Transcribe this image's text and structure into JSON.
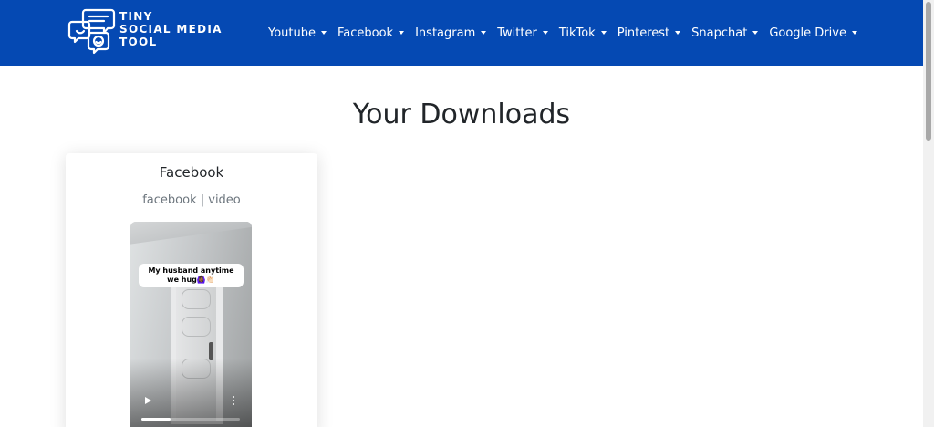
{
  "header": {
    "brand": [
      "TINY",
      "SOCIAL MEDIA",
      "TOOL"
    ],
    "nav": [
      "Youtube",
      "Facebook",
      "Instagram",
      "Twitter",
      "TikTok",
      "Pinterest",
      "Snapchat",
      "Google Drive"
    ]
  },
  "main": {
    "title": "Your Downloads",
    "card": {
      "title": "Facebook",
      "subtitle": "facebook | video",
      "video": {
        "caption": "My husband anytime we hug🙆🏾‍♀️👏🏻",
        "progress": 0.3
      }
    }
  },
  "icons": {
    "logo": "chat-bubbles-smiley-icon",
    "play": "play-icon",
    "more": "more-vertical-icon",
    "dropdown": "caret-down-icon"
  },
  "colors": {
    "header_bg": "#0549b3",
    "text_dark": "#212529",
    "text_muted": "#6c757d"
  }
}
